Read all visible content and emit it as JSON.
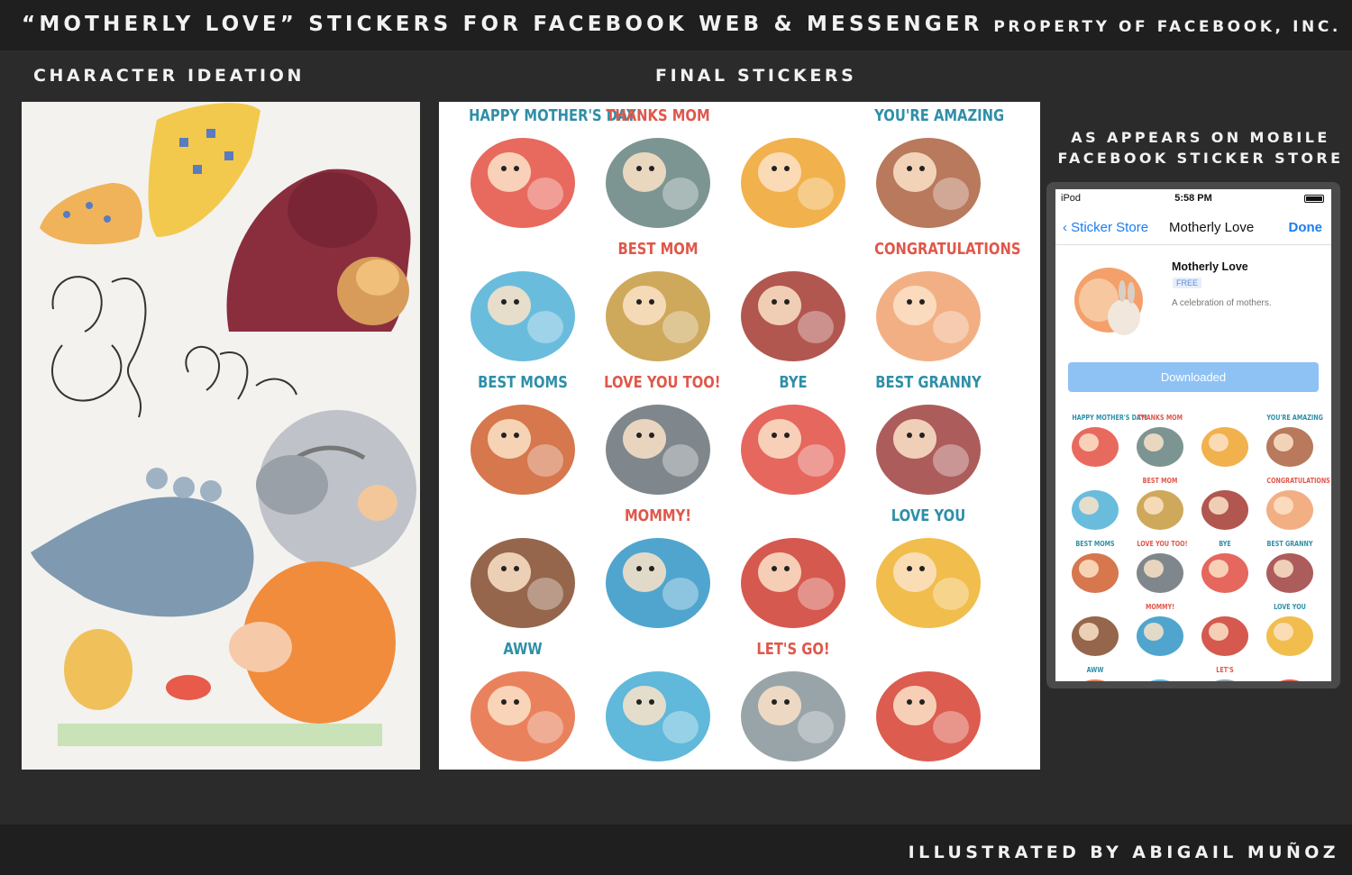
{
  "header": {
    "title": "“MOTHERLY LOVE” STICKERS FOR FACEBOOK WEB & MESSENGER",
    "property": "PROPERTY OF FACEBOOK, INC."
  },
  "sections": {
    "ideation": "CHARACTER IDEATION",
    "final": "FINAL STICKERS",
    "mobile_line1": "AS APPEARS ON MOBILE",
    "mobile_line2": "FACEBOOK STICKER STORE"
  },
  "stickers": [
    {
      "caption": "HAPPY MOTHER'S DAY!",
      "color": "#2f8fa8",
      "icon": "hen-with-chicks"
    },
    {
      "caption": "THANKS MOM",
      "color": "#e0574a",
      "icon": "elephant-with-calf"
    },
    {
      "caption": "",
      "color": "#e0574a",
      "icon": "monkey-with-baby"
    },
    {
      "caption": "YOU'RE AMAZING",
      "color": "#2f8fa8",
      "icon": "bear-and-iguana"
    },
    {
      "caption": "",
      "color": "#2f8fa8",
      "icon": "mouse-with-flower"
    },
    {
      "caption": "BEST MOM",
      "color": "#e0574a",
      "icon": "dolphin-with-calf"
    },
    {
      "caption": "",
      "color": "#e0574a",
      "icon": "dachshund-family"
    },
    {
      "caption": "CONGRATULATIONS",
      "color": "#e0574a",
      "icon": "hamster-with-bunny"
    },
    {
      "caption": "BEST MOMS",
      "color": "#2f8fa8",
      "icon": "squirrel-moms"
    },
    {
      "caption": "LOVE YOU TOO!",
      "color": "#e0574a",
      "icon": "wolf-with-cub"
    },
    {
      "caption": "BYE",
      "color": "#2f8fa8",
      "icon": "birds-waving"
    },
    {
      "caption": "BEST GRANNY",
      "color": "#2f8fa8",
      "icon": "owl-granny"
    },
    {
      "caption": "",
      "color": "#e0574a",
      "icon": "bear-hug"
    },
    {
      "caption": "MOMMY!",
      "color": "#e0574a",
      "icon": "baby-birds-nest"
    },
    {
      "caption": "",
      "color": "#e0574a",
      "icon": "red-panda-heart"
    },
    {
      "caption": "LOVE YOU",
      "color": "#2f8fa8",
      "icon": "giraffe-with-calf"
    },
    {
      "caption": "AWW",
      "color": "#2f8fa8",
      "icon": "cat-with-kitten"
    },
    {
      "caption": "",
      "color": "#2f8fa8",
      "icon": "otter-in-water"
    },
    {
      "caption": "LET'S GO!",
      "color": "#e0574a",
      "icon": "opossum-family"
    },
    {
      "caption": "",
      "color": "#e0574a",
      "icon": "tiger-with-cub"
    }
  ],
  "phone": {
    "carrier": "iPod",
    "time": "5:58 PM",
    "nav_back": "Sticker Store",
    "nav_title": "Motherly Love",
    "nav_done": "Done",
    "pack_name": "Motherly Love",
    "pack_price": "FREE",
    "pack_desc": "A celebration of mothers.",
    "download_button": "Downloaded",
    "mini_captions": [
      "HAPPY MOTHER'S DAY!",
      "THANKS MOM",
      "",
      "YOU'RE AMAZING",
      "",
      "BEST MOM",
      "",
      "CONGRATULATIONS",
      "BEST MOMS",
      "LOVE YOU TOO!",
      "BYE",
      "BEST GRANNY",
      "",
      "MOMMY!",
      "",
      "LOVE YOU",
      "AWW",
      "",
      "LET'S",
      ""
    ]
  },
  "footer": {
    "credit": "ILLUSTRATED BY ABIGAIL MUÑOZ"
  },
  "colors": {
    "background": "#2b2b2b",
    "bar": "#1f1f1f",
    "caption_red": "#e0574a",
    "caption_blue": "#2f8fa8",
    "ios_blue": "#1a7cf3"
  }
}
